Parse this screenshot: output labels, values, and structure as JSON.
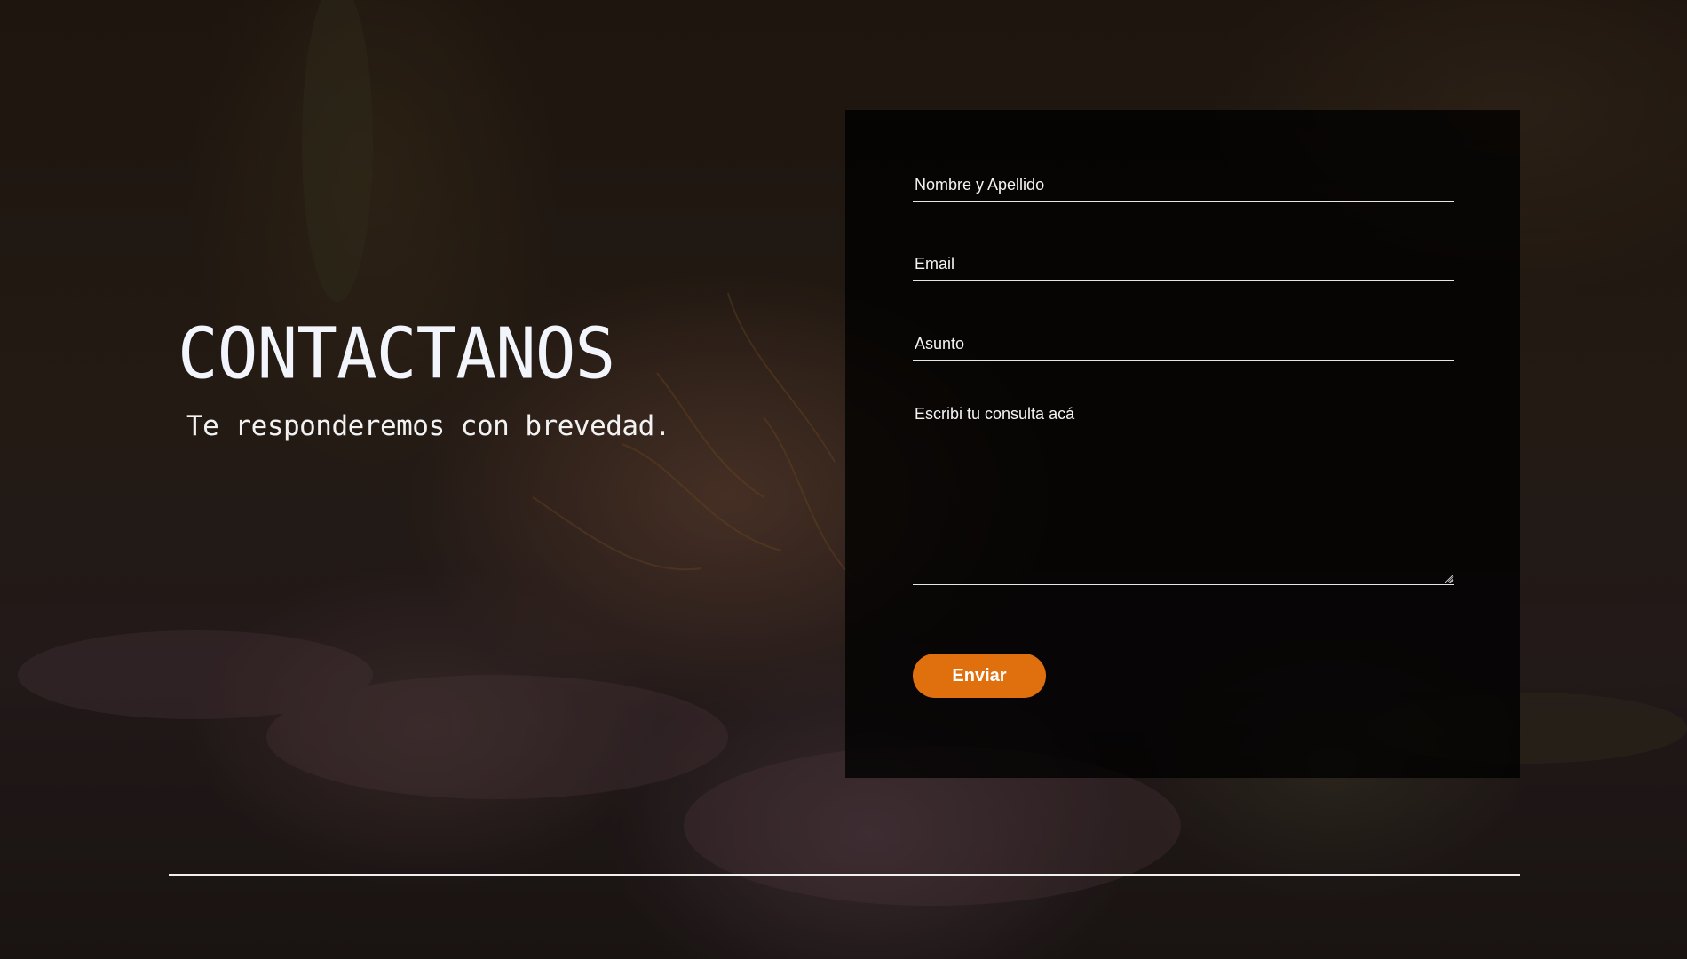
{
  "hero": {
    "title": "CONTACTANOS",
    "subtitle": "Te responderemos con brevedad."
  },
  "form": {
    "name_placeholder": "Nombre y Apellido",
    "email_placeholder": "Email",
    "subject_placeholder": "Asunto",
    "message_placeholder": "Escribi tu consulta acá",
    "submit_label": "Enviar"
  },
  "colors": {
    "accent": "#e0700e",
    "text": "#f2f5fb",
    "card_background": "#000000"
  }
}
